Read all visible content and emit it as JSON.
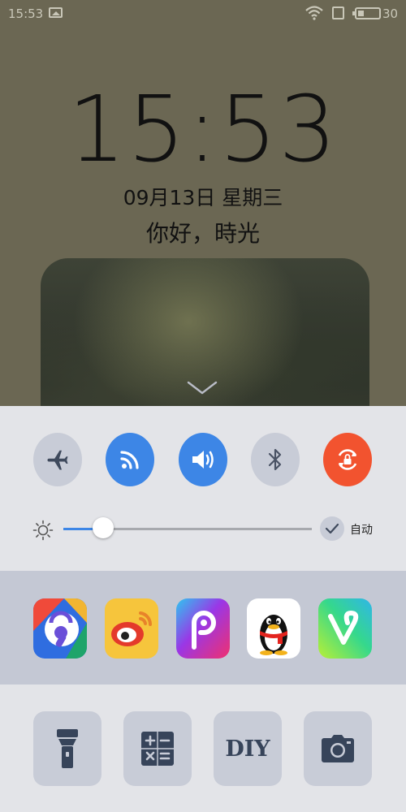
{
  "status_bar": {
    "time": "15:53",
    "battery_level": "30",
    "battery_fraction": 0.3
  },
  "lockscreen": {
    "clock": "15:53",
    "date": "09月13日 星期三",
    "greeting": "你好，時光"
  },
  "quick_toggles": [
    {
      "name": "airplane",
      "icon": "airplane-icon",
      "state": "off"
    },
    {
      "name": "wifi",
      "icon": "wifi-icon",
      "state": "on"
    },
    {
      "name": "sound",
      "icon": "speaker-icon",
      "state": "on"
    },
    {
      "name": "bluetooth",
      "icon": "bluetooth-icon",
      "state": "off"
    },
    {
      "name": "rotation-lock",
      "icon": "rotation-lock-icon",
      "state": "on"
    }
  ],
  "brightness": {
    "level": 0.16,
    "auto_label": "自动",
    "auto_checked": true
  },
  "apps": [
    {
      "icon": "app-lock-icon"
    },
    {
      "icon": "weibo-icon"
    },
    {
      "icon": "picsart-icon"
    },
    {
      "icon": "qq-penguin-icon"
    },
    {
      "icon": "vue-vlog-icon"
    }
  ],
  "tools": {
    "flashlight": {
      "icon": "flashlight-icon"
    },
    "calculator": {
      "icon": "calculator-icon"
    },
    "diy": {
      "label": "DIY"
    },
    "camera": {
      "icon": "camera-icon"
    }
  },
  "colors": {
    "accent": "#3d86e6",
    "orange": "#f2532f",
    "toggle_off": "#c8ccd7",
    "panel_bg": "#e3e4e8",
    "apps_bg": "#c4c8d4"
  }
}
